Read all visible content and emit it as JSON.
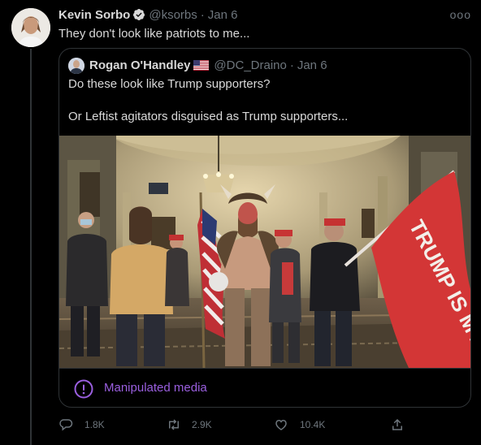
{
  "tweet": {
    "author_name": "Kevin Sorbo",
    "author_handle": "@ksorbs",
    "separator": "·",
    "date": "Jan 6",
    "text": "They don't look like patriots to me...",
    "more_label": "ooo"
  },
  "quoted_tweet": {
    "author_name": "Rogan O'Handley",
    "author_handle": "@DC_Draino",
    "separator": "·",
    "date": "Jan 6",
    "line_1": "Do these look like Trump supporters?",
    "line_2": "Or Leftist agitators disguised as Trump supporters...",
    "flag_text": "TRUMP IS MY PRESIDENT",
    "label": "Manipulated media"
  },
  "actions": {
    "replies": "1.8K",
    "retweets": "2.9K",
    "likes": "10.4K"
  },
  "colors": {
    "background": "#000000",
    "text": "#d9d9d9",
    "muted": "#6e767d",
    "border": "#2f3336",
    "verified": "#d9d9d9",
    "manipulated_accent": "#9a5fdf"
  }
}
